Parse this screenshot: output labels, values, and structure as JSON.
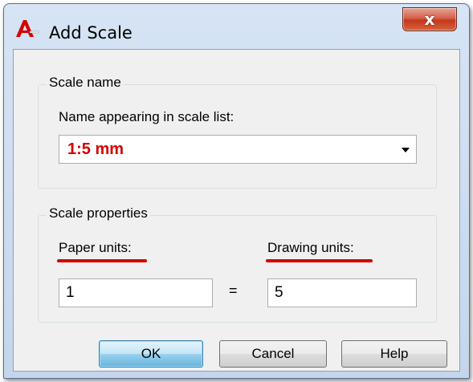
{
  "window": {
    "title": "Add Scale",
    "close_label": "x"
  },
  "scale_name": {
    "group_label": "Scale name",
    "field_label": "Name appearing in scale list:",
    "value": "1:5 mm"
  },
  "scale_properties": {
    "group_label": "Scale properties",
    "paper_units_label": "Paper units:",
    "paper_units_value": "1",
    "equals": "=",
    "drawing_units_label": "Drawing units:",
    "drawing_units_value": "5"
  },
  "buttons": {
    "ok": "OK",
    "cancel": "Cancel",
    "help": "Help"
  },
  "colors": {
    "highlight_red": "#d40000",
    "title_bar": "#c5d6ec",
    "close_button": "#c5361b"
  }
}
